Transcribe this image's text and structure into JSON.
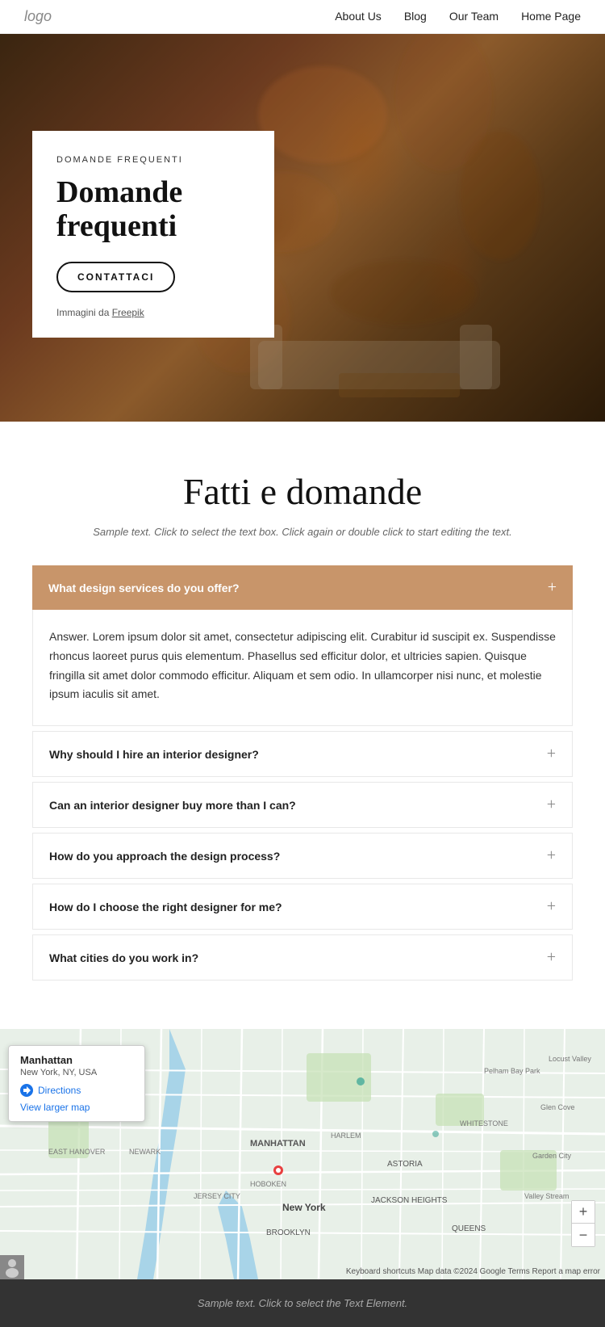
{
  "nav": {
    "logo": "logo",
    "links": [
      {
        "label": "About Us",
        "href": "#"
      },
      {
        "label": "Blog",
        "href": "#"
      },
      {
        "label": "Our Team",
        "href": "#"
      },
      {
        "label": "Home Page",
        "href": "#"
      }
    ]
  },
  "hero": {
    "card": {
      "label": "DOMANDE FREQUENTI",
      "title": "Domande frequenti",
      "button": "CONTATTACI",
      "footer_text": "Immagini da ",
      "footer_link": "Freepik"
    }
  },
  "faq": {
    "section_title": "Fatti e domande",
    "section_subtitle": "Sample text. Click to select the text box. Click again or double click to start editing the text.",
    "active_question": "What design services do you offer?",
    "active_answer": "Answer. Lorem ipsum dolor sit amet, consectetur adipiscing elit. Curabitur id suscipit ex. Suspendisse rhoncus laoreet purus quis elementum. Phasellus sed efficitur dolor, et ultricies sapien. Quisque fringilla sit amet dolor commodo efficitur. Aliquam et sem odio. In ullamcorper nisi nunc, et molestie ipsum iaculis sit amet.",
    "items": [
      {
        "question": "Why should I hire an interior designer?"
      },
      {
        "question": "Can an interior designer buy more than I can?"
      },
      {
        "question": "How do you approach the design process?"
      },
      {
        "question": "How do I choose the right designer for me?"
      },
      {
        "question": "What cities do you work in?"
      }
    ]
  },
  "map": {
    "popup_title": "Manhattan",
    "popup_subtitle": "New York, NY, USA",
    "directions_label": "Directions",
    "larger_map_label": "View larger map",
    "zoom_in": "+",
    "zoom_out": "−",
    "credits": "Keyboard shortcuts  Map data ©2024 Google  Terms  Report a map error"
  },
  "footer": {
    "text": "Sample text. Click to select the Text Element."
  }
}
